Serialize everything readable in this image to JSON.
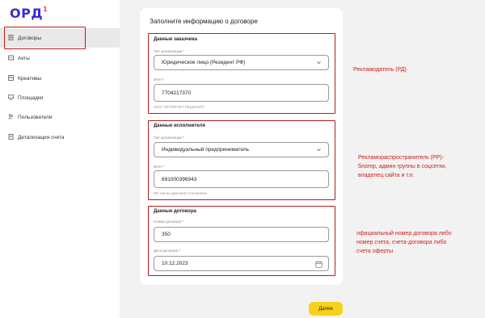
{
  "logo": {
    "text": "ОРД",
    "sup": "1"
  },
  "sidebar": {
    "items": [
      {
        "label": "Договоры",
        "icon": "document-icon",
        "active": true
      },
      {
        "label": "Акты",
        "icon": "acts-icon"
      },
      {
        "label": "Креативы",
        "icon": "creatives-icon"
      },
      {
        "label": "Площадки",
        "icon": "monitor-icon"
      },
      {
        "label": "Пользователи",
        "icon": "users-icon"
      },
      {
        "label": "Детализация счета",
        "icon": "receipt-icon"
      }
    ]
  },
  "form": {
    "title": "Заполните информацию о договоре",
    "customer": {
      "title": "Данные заказчика",
      "org_type_label": "Тип организации",
      "org_type_value": "Юридическое лицо (Резидент РФ)",
      "inn_label": "ИНН",
      "inn_value": "7704217370",
      "name_hint": "ООО \"ИНТЕРНЕТ РЕШЕНИЯ\""
    },
    "executor": {
      "title": "Данные исполнителя",
      "org_type_label": "Тип организации",
      "org_type_value": "Индивидуальный предприниматель",
      "inn_label": "ИНН",
      "inn_value": "691000396943",
      "name_hint": "ИП Хапин Дмитрий Степанович"
    },
    "contract": {
      "title": "Данные договора",
      "number_label": "Номер договора",
      "number_value": "350",
      "date_label": "Дата договора",
      "date_value": "10.12.2023"
    },
    "required_mark": "*",
    "next_label": "Далее"
  },
  "annotations": {
    "advertiser": "Рекламодатель (РД)",
    "distributor": [
      "Рекламораспространитель (РР)-",
      "блогер, админ группы в соцсетях,",
      "владелец сайта и т.п."
    ],
    "contract_note": [
      "официальный номер договора либо",
      "номер счета, счета-договора либо",
      "счета оферты"
    ]
  },
  "colors": {
    "logo": "#3b2bd6",
    "annotation_red": "#d21c1c",
    "next_button": "#f7d117",
    "active_nav_bg": "#e9e9e9"
  }
}
